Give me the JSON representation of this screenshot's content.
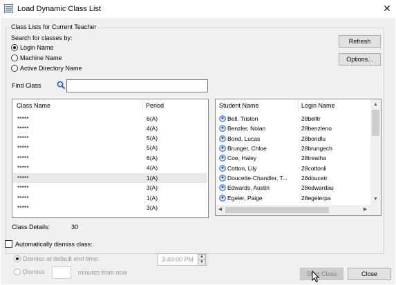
{
  "window": {
    "title": "Load Dynamic Class List",
    "close_glyph": "✕",
    "icon": "window-list-icon"
  },
  "group": {
    "legend": "Class Lists for Current Teacher",
    "search_label": "Search for classes by:",
    "options": [
      {
        "label": "Login Name",
        "selected": true
      },
      {
        "label": "Machine Name",
        "selected": false
      },
      {
        "label": "Active Directory Name",
        "selected": false
      }
    ],
    "refresh_label": "Refresh",
    "options_button_label": "Options...",
    "find_label": "Find Class",
    "find_value": "",
    "search_icon": "search-icon"
  },
  "class_list": {
    "headers": [
      "Class Name",
      "Period"
    ],
    "rows": [
      {
        "name": "*****",
        "period": "6(A)"
      },
      {
        "name": "*****",
        "period": "4(A)"
      },
      {
        "name": "*****",
        "period": "5(A)"
      },
      {
        "name": "*****",
        "period": "5(A)"
      },
      {
        "name": "*****",
        "period": "6(A)"
      },
      {
        "name": "*****",
        "period": "4(A)"
      },
      {
        "name": "*****",
        "period": "1(A)",
        "selected": true
      },
      {
        "name": "*****",
        "period": "3(A)"
      },
      {
        "name": "*****",
        "period": "1(A)"
      },
      {
        "name": "*****",
        "period": "3(A)"
      }
    ]
  },
  "student_list": {
    "headers": [
      "Student Name",
      "Login Name"
    ],
    "rows": [
      {
        "name": "Bell, Triston",
        "login": "28belltr"
      },
      {
        "name": "Benzler, Nolan",
        "login": "28benzleno"
      },
      {
        "name": "Bond, Lucas",
        "login": "28bondlu"
      },
      {
        "name": "Brunger, Chloe",
        "login": "28brungech"
      },
      {
        "name": "Coe, Haley",
        "login": "28treatha"
      },
      {
        "name": "Cotton, Lily",
        "login": "28cottonli"
      },
      {
        "name": "Doucette-Chandler, T...",
        "login": "28doucetr"
      },
      {
        "name": "Edwards, Austin",
        "login": "28edwardau"
      },
      {
        "name": "Egeler, Paige",
        "login": "28egelerpa"
      }
    ],
    "student_icon": "student-avatar-icon"
  },
  "details": {
    "label": "Class Details:",
    "count": "30"
  },
  "auto_dismiss": {
    "label": "Automatically dismiss class:",
    "checked": false,
    "default_end_label": "Dismiss at default end time:",
    "dismiss_label": "Dismiss",
    "minutes_label": "minutes from now",
    "time_value": "3:40:00 PM",
    "minutes_value": ""
  },
  "footer": {
    "start_label": "Start Class",
    "close_label": "Close"
  },
  "colors": {
    "accent": "#1f5fbf",
    "dialog_bg": "#f0f0f0",
    "selection": "#e8e8e8"
  }
}
